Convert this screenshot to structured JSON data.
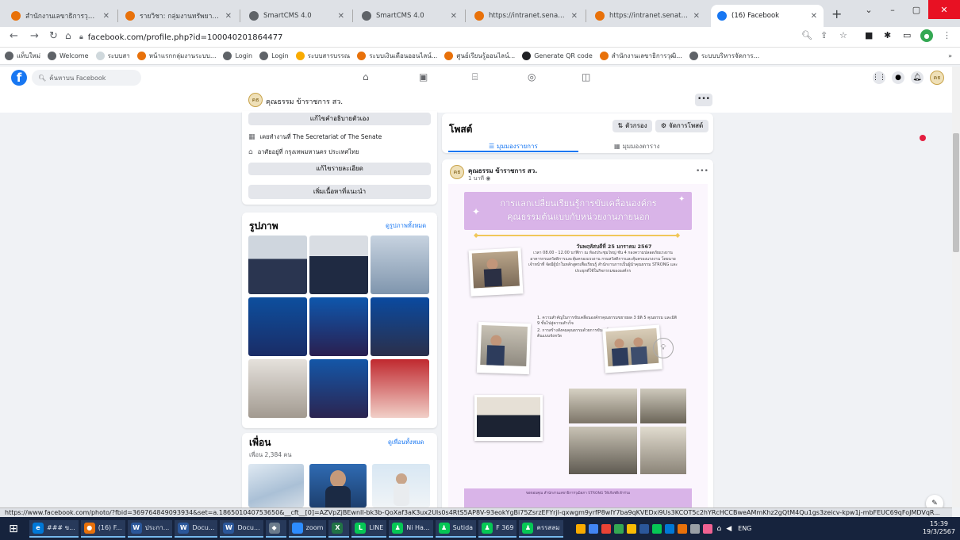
{
  "tabs": [
    {
      "title": "สำนักงานเลขาธิการวุฒิสภา",
      "color": "#e8710a"
    },
    {
      "title": "รายวิชา: กลุ่มงานทรัพยากรบุคคล",
      "color": "#e8710a"
    },
    {
      "title": "SmartCMS 4.0",
      "color": "#5f6368"
    },
    {
      "title": "SmartCMS 4.0",
      "color": "#5f6368"
    },
    {
      "title": "https://intranet.senate.go.th",
      "color": "#e8710a"
    },
    {
      "title": "https://intranet.senate.go.th",
      "color": "#e8710a"
    },
    {
      "title": "(16) Facebook",
      "color": "#1877f2"
    }
  ],
  "address": {
    "url": "facebook.com/profile.php?id=100040201864477"
  },
  "bookmarks": [
    {
      "label": "แท็บใหม่",
      "color": "#5f6368"
    },
    {
      "label": "Welcome",
      "color": "#5f6368"
    },
    {
      "label": "ระบบสา",
      "color": "#cfd8dc"
    },
    {
      "label": "หน้าแรกกลุ่มงานระบบ...",
      "color": "#e8710a"
    },
    {
      "label": "Login",
      "color": "#5f6368"
    },
    {
      "label": "Login",
      "color": "#5f6368"
    },
    {
      "label": "ระบบสารบรรณ",
      "color": "#f9ab00"
    },
    {
      "label": "ระบบเงินเดือนออนไลน์...",
      "color": "#e8710a"
    },
    {
      "label": "ศูนย์เรียนรู้ออนไลน์...",
      "color": "#e8710a"
    },
    {
      "label": "Generate QR code",
      "color": "#202124"
    },
    {
      "label": "สำนักงานเลขาธิการวุฒิ...",
      "color": "#e8710a"
    },
    {
      "label": "ระบบบริหารจัดการ...",
      "color": "#5f6368"
    }
  ],
  "fb": {
    "search_placeholder": "ค้นหาบน Facebook"
  },
  "profile": {
    "name": "คุณธรรม ข้าราชการ สว.",
    "edit_bio": "แก้ไขคำอธิบายตัวเอง",
    "workplace": "เคยทำงานที่ The Secretariat of The Senate",
    "lives_in": "อาศัยอยู่ที่ กรุงเทพมหานคร ประเทศไทย",
    "edit_details": "แก้ไขรายละเอียด",
    "add_featured": "เพิ่มเนื้อหาที่แนะนำ"
  },
  "photos": {
    "title": "รูปภาพ",
    "see_all": "ดูรูปภาพทั้งหมด"
  },
  "friends": {
    "title": "เพื่อน",
    "count": "เพื่อน 2,384 คน",
    "see_all": "ดูเพื่อนทั้งหมด"
  },
  "posts": {
    "title": "โพสต์",
    "filter": "ตัวกรอง",
    "manage": "จัดการโพสต์",
    "list_view": "มุมมองรายการ",
    "grid_view": "มุมมองตาราง",
    "author": "คุณธรรม ข้าราชการ สว.",
    "time": "1 นาที"
  },
  "flyer": {
    "title": "การแลกเปลี่ยนเรียนรู้การขับเคลื่อนองค์กร คุณธรรมต้นแบบกับหน่วยงานภายนอก",
    "date": "วันพฤหัสบดีที่ 25 มกราคม 2567",
    "body": "เวลา 08.00 - 12.00 นาฬิกา ณ ห้องประชุมใหญ่ ชั้น 4 กองความปลอดภัยแรงงาน อาคารกรมสวัสดิการและคุ้มครองแรงงาน กรมสวัสดิการและคุ้มครองแรงงาน โดยนายเจ้าหน้าที่ จัดมีผู้นำในหลักสูตรเพื่อเรียนรู้ สำนักงานการเป็นผู้นำคุณธรรม STRONG และประยุกต์ใช้ในกิจกรรมขององค์กร",
    "point1": "1. ความสำคัญในการขับเคลื่อนองค์กรคุณธรรมขยายผล 3 มิติ 5 คุณธรรม และมิติ 9 ขั้นไปสู่ความสำเร็จ",
    "point2": "2. การสร้างสังคมคุณธรรมด้วยการขับเคลื่อนองค์กรคุณธรรมต้นแบบจังหวัด",
    "footer": "ขอขอบคุณ สำนักงานเลขาธิการวุฒิสภา STRONG ให้เกียรติเข้าร่วม"
  },
  "status_url": "https://www.facebook.com/photo/?fbid=369764849093934&set=a.186501040753650&__cft__[0]=AZVpZjBEwnlI-bk3b-QoXaf3aK3ux2Uls0s4RtS5AP8V-93eokYgBi75ZsrzEFYrjl-qxwgm9yrfP8wlY7ba9qKVEDxi9Us3KCOT5c2hYRcHCCBweAMmKhz2gQtM4Qu1gs3zeicv-kpw1j-mbFEUC69qFoJMDVqR...",
  "taskbar": [
    {
      "label": "### ข...",
      "color": "#0078d7",
      "icon": "e"
    },
    {
      "label": "(16) F...",
      "color": "#e8710a",
      "icon": "●"
    },
    {
      "label": "ประกา...",
      "color": "#2b579a",
      "icon": "W"
    },
    {
      "label": "Docu...",
      "color": "#2b579a",
      "icon": "W"
    },
    {
      "label": "Docu...",
      "color": "#2b579a",
      "icon": "W"
    },
    {
      "label": "",
      "color": "#6b7b8c",
      "icon": "◆"
    },
    {
      "label": "zoom",
      "color": "#2d8cff",
      "icon": ""
    },
    {
      "label": "",
      "color": "#217346",
      "icon": "X"
    },
    {
      "label": "LINE",
      "color": "#06c755",
      "icon": "L"
    },
    {
      "label": "Ni Ha...",
      "color": "#06c755",
      "icon": "♟"
    },
    {
      "label": "Sutida",
      "color": "#06c755",
      "icon": "♟"
    },
    {
      "label": "F 369",
      "color": "#06c755",
      "icon": "♟"
    },
    {
      "label": "ครรสลม",
      "color": "#06c755",
      "icon": "♟"
    }
  ],
  "tray": {
    "lang": "ENG",
    "time": "15:39",
    "date": "19/3/2567"
  }
}
